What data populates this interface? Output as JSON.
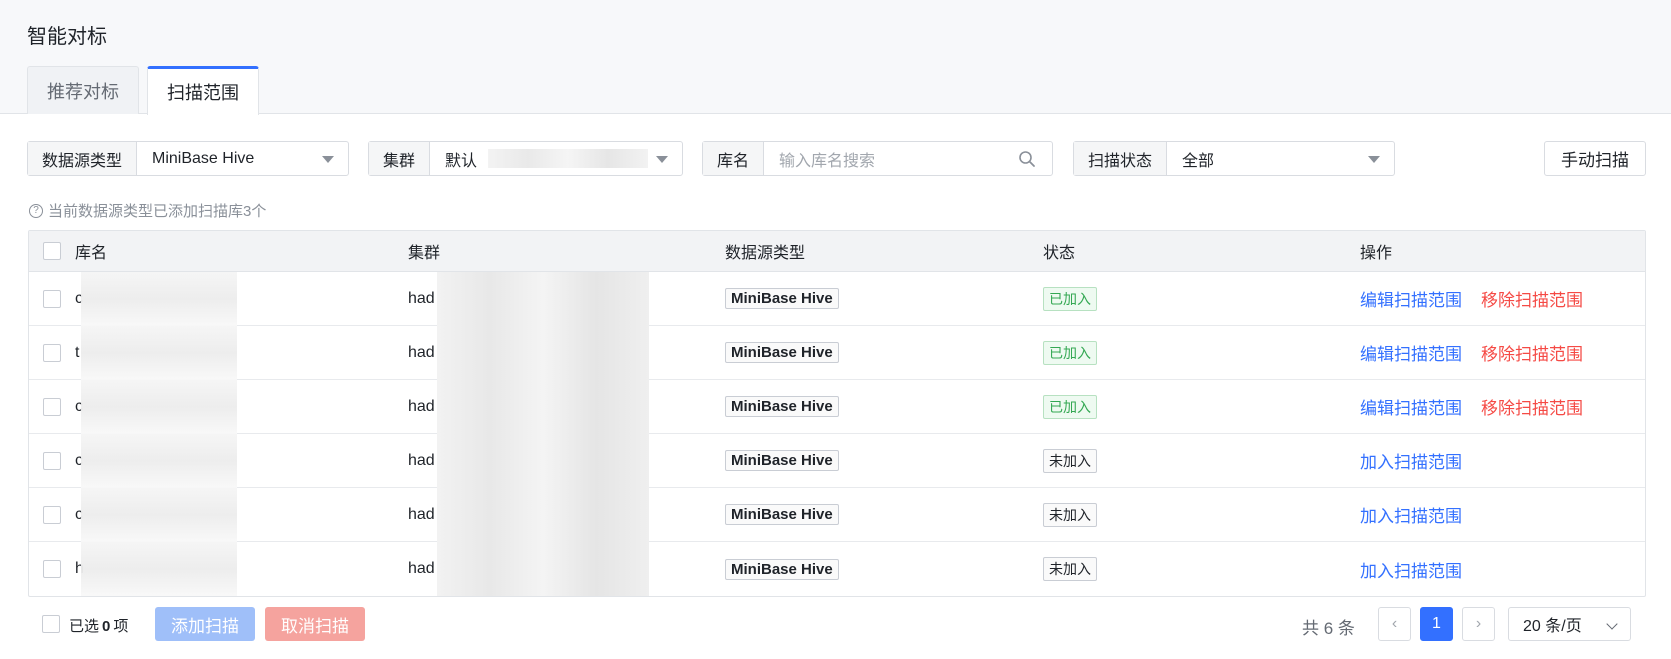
{
  "page": {
    "title": "智能对标"
  },
  "tabs": [
    {
      "label": "推荐对标"
    },
    {
      "label": "扫描范围"
    }
  ],
  "filters": {
    "datasource": {
      "label": "数据源类型",
      "value": "MiniBase Hive"
    },
    "cluster": {
      "label": "集群",
      "value": "默认"
    },
    "db": {
      "label": "库名",
      "placeholder": "输入库名搜索"
    },
    "status": {
      "label": "扫描状态",
      "value": "全部"
    }
  },
  "manual_scan_label": "手动扫描",
  "hint": "当前数据源类型已添加扫描库3个",
  "table": {
    "headers": {
      "db": "库名",
      "cluster": "集群",
      "type": "数据源类型",
      "status": "状态",
      "action": "操作"
    },
    "rows": [
      {
        "db": "c",
        "cluster": "had",
        "type": "MiniBase Hive",
        "status": "已加入",
        "joined": true,
        "edit": "编辑扫描范围",
        "remove": "移除扫描范围"
      },
      {
        "db": "t",
        "cluster": "had",
        "type": "MiniBase Hive",
        "status": "已加入",
        "joined": true,
        "edit": "编辑扫描范围",
        "remove": "移除扫描范围"
      },
      {
        "db": "c",
        "cluster": "had",
        "type": "MiniBase Hive",
        "status": "已加入",
        "joined": true,
        "edit": "编辑扫描范围",
        "remove": "移除扫描范围"
      },
      {
        "db": "c",
        "cluster": "had",
        "type": "MiniBase Hive",
        "status": "未加入",
        "joined": false,
        "add": "加入扫描范围"
      },
      {
        "db": "c",
        "cluster": "had",
        "type": "MiniBase Hive",
        "status": "未加入",
        "joined": false,
        "add": "加入扫描范围"
      },
      {
        "db": "h",
        "cluster": "had",
        "type": "MiniBase Hive",
        "status": "未加入",
        "joined": false,
        "add": "加入扫描范围"
      }
    ]
  },
  "footer": {
    "selected_prefix": "已选",
    "selected_count": "0",
    "selected_suffix": "项",
    "add_scan": "添加扫描",
    "cancel_scan": "取消扫描",
    "total": "共 6 条",
    "current_page": "1",
    "prev": "‹",
    "next": "›",
    "page_size": "20 条/页"
  },
  "colors": {
    "primary": "#3370ff",
    "danger": "#f54a45",
    "success": "#34a853"
  }
}
